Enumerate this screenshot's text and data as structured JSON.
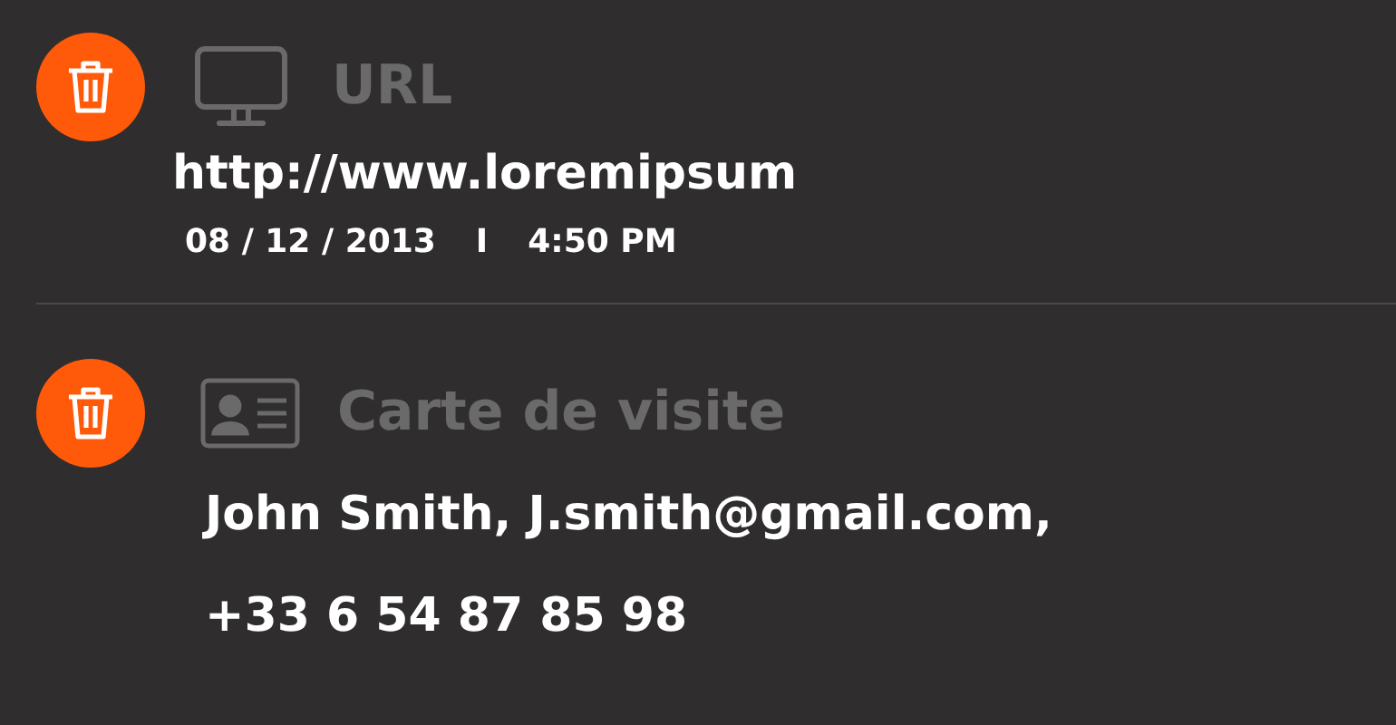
{
  "entries": [
    {
      "kind": "url",
      "title": "URL",
      "lines": [
        "http://www.loremipsum"
      ],
      "date": "08 / 12 / 2013",
      "separator": "I",
      "time": "4:50 PM"
    },
    {
      "kind": "card",
      "title": "Carte de visite",
      "lines": [
        "John Smith, J.smith@gmail.com,",
        "+33 6 54 87 85 98"
      ]
    }
  ]
}
